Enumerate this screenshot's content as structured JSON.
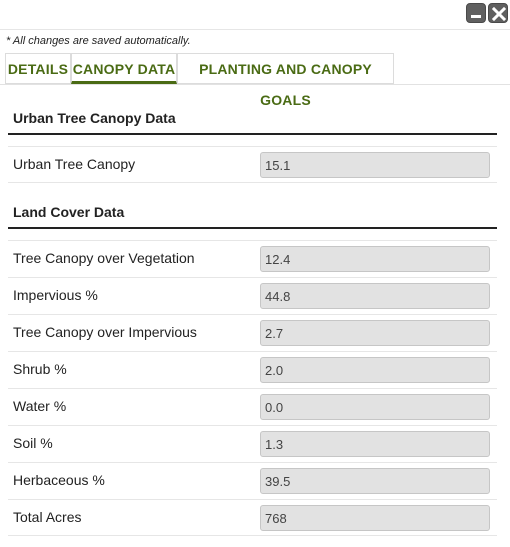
{
  "window": {
    "minimize_icon": "minimize-icon",
    "close_icon": "close-icon"
  },
  "note": "* All changes are saved automatically.",
  "tabs": [
    {
      "label": "DETAILS"
    },
    {
      "label": "CANOPY DATA",
      "active": true
    },
    {
      "label": "PLANTING AND CANOPY GOALS"
    }
  ],
  "sections": {
    "urban": {
      "title": "Urban Tree Canopy Data",
      "rows": [
        {
          "label": "Urban Tree Canopy",
          "value": "15.1"
        }
      ]
    },
    "land": {
      "title": "Land Cover Data",
      "rows": [
        {
          "label": "Tree Canopy over Vegetation",
          "value": "12.4"
        },
        {
          "label": "Impervious %",
          "value": "44.8"
        },
        {
          "label": "Tree Canopy over Impervious",
          "value": "2.7"
        },
        {
          "label": "Shrub %",
          "value": "2.0"
        },
        {
          "label": "Water %",
          "value": "0.0"
        },
        {
          "label": "Soil %",
          "value": "1.3"
        },
        {
          "label": "Herbaceous %",
          "value": "39.5"
        },
        {
          "label": "Total Acres",
          "value": "768"
        }
      ]
    }
  },
  "colors": {
    "accent": "#4a6b14",
    "field_bg": "#e2e2e2"
  }
}
